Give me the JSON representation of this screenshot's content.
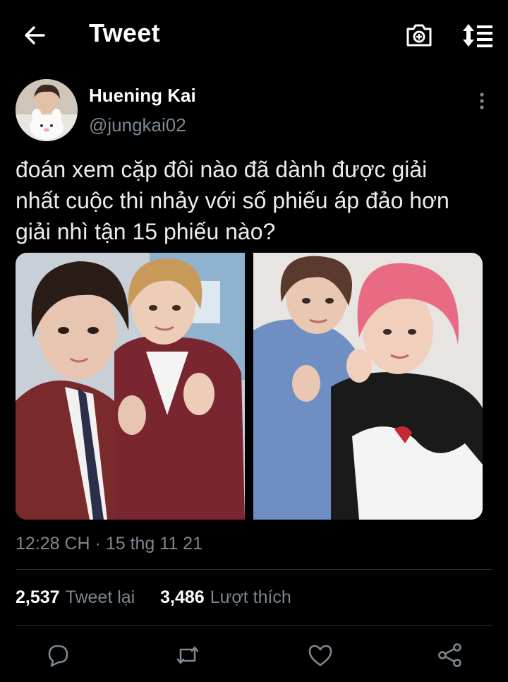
{
  "header": {
    "title": "Tweet",
    "back_icon": "arrow-left-icon",
    "camera_icon": "camera-plus-icon",
    "sort_icon": "sort-lines-icon"
  },
  "author": {
    "name": "Huening Kai",
    "handle": "@jungkai02"
  },
  "tweet": {
    "text_lines": [
      "đoán xem cặp đôi nào đã dành được giải",
      "nhất cuộc thi nhảy với số phiếu áp đảo hơn",
      "giải nhì tận 15 phiếu nào?"
    ],
    "timestamp": "12:28 CH · 15 thg 11 21"
  },
  "stats": {
    "retweets_count": "2,537",
    "retweets_label": "Tweet lại",
    "likes_count": "3,486",
    "likes_label": "Lượt thích"
  },
  "actions": [
    "reply-icon",
    "retweet-icon",
    "like-icon",
    "share-icon"
  ],
  "colors": {
    "background": "#000000",
    "text_primary": "#ffffff",
    "text_secondary": "#7c8791",
    "divider": "#2f3336"
  }
}
